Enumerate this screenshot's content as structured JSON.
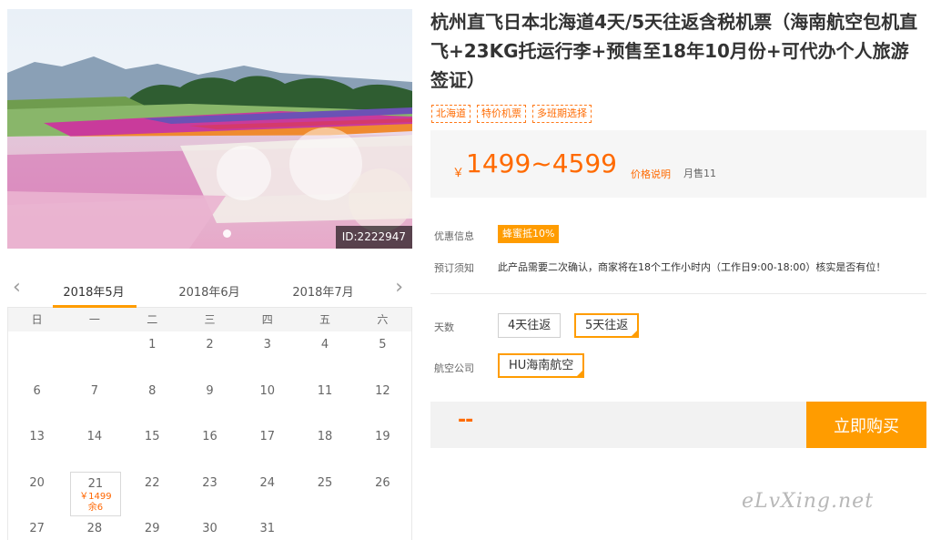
{
  "photo": {
    "id_label": "ID:2222947"
  },
  "calendar": {
    "months": [
      "2018年5月",
      "2018年6月",
      "2018年7月"
    ],
    "weekdays": [
      "日",
      "一",
      "二",
      "三",
      "四",
      "五",
      "六"
    ],
    "days": [
      "",
      "",
      "1",
      "2",
      "3",
      "4",
      "5",
      "6",
      "7",
      "8",
      "9",
      "10",
      "11",
      "12",
      "13",
      "14",
      "15",
      "16",
      "17",
      "18",
      "19",
      "20",
      "21",
      "22",
      "23",
      "24",
      "25",
      "26",
      "27",
      "28",
      "29",
      "30",
      "31",
      "",
      ""
    ],
    "selected": {
      "day": "21",
      "price": "￥1499",
      "remaining": "余6"
    }
  },
  "product": {
    "title": "杭州直飞日本北海道4天/5天往返含税机票（海南航空包机直飞+23KG托运行李+预售至18年10月份+可代办个人旅游签证）",
    "tags": [
      "北海道",
      "特价机票",
      "多班期选择"
    ]
  },
  "price": {
    "currency": "￥",
    "value": "1499~4599",
    "note": "价格说明",
    "sold": "月售11"
  },
  "info": {
    "promo_label": "优惠信息",
    "promo_badge": "蜂蜜抵10%",
    "notice_label": "预订须知",
    "notice_text": "此产品需要二次确认，商家将在18个工作小时内（工作日9:00-18:00）核实是否有位！"
  },
  "options": {
    "days_label": "天数",
    "days": [
      "4天往返",
      "5天往返"
    ],
    "airline_label": "航空公司",
    "airline": "HU海南航空"
  },
  "purchase": {
    "qty": "--",
    "buy_label": "立即购买"
  },
  "watermark": "eLvXing.net",
  "colors": {
    "accent": "#ff9c00",
    "price": "#ff6a00"
  }
}
